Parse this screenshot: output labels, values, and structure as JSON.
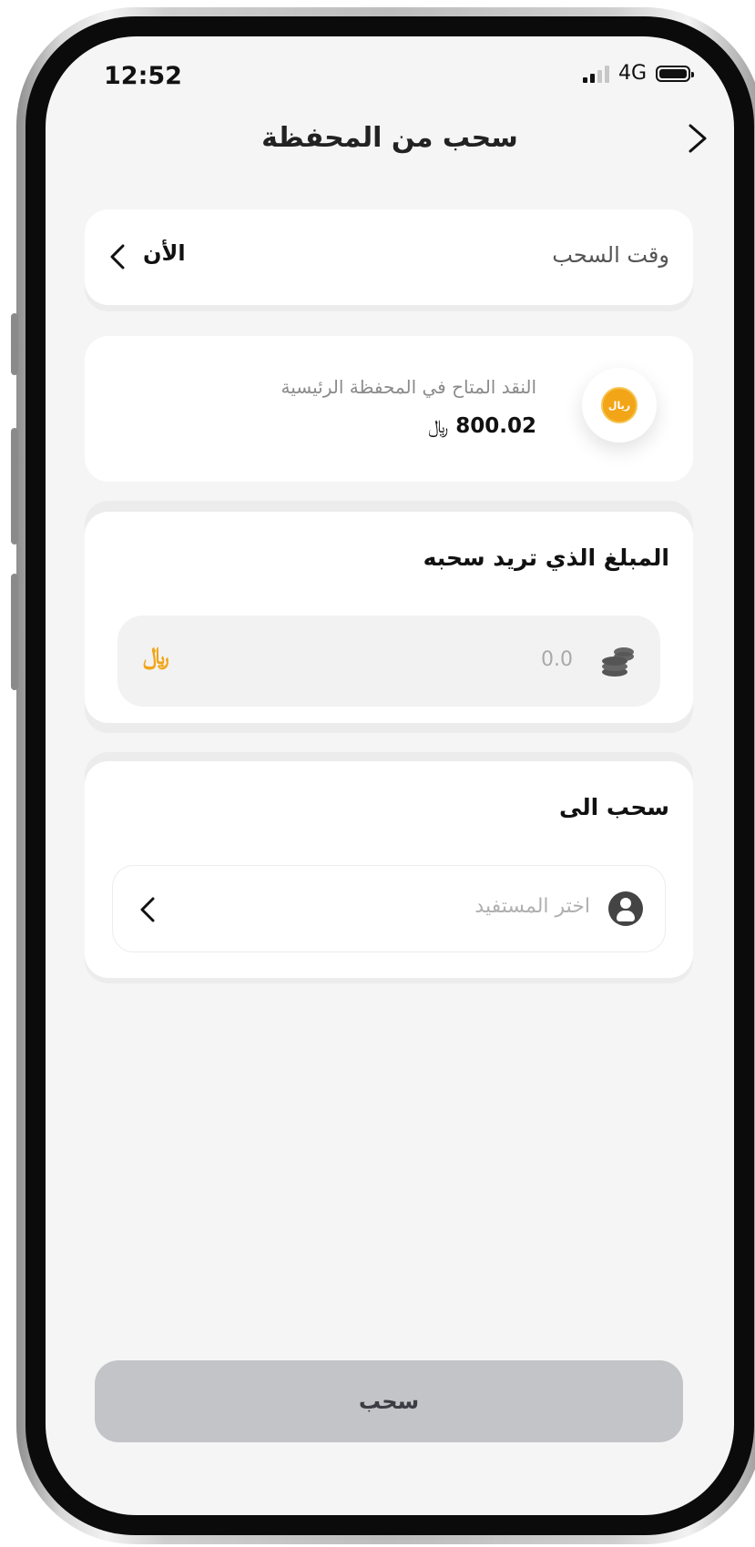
{
  "status_bar": {
    "time": "12:52",
    "network": "4G"
  },
  "header": {
    "title": "سحب من المحفظة"
  },
  "withdraw_time": {
    "label": "وقت السحب",
    "value": "الأن"
  },
  "wallet": {
    "label": "النقد المتاح في المحفظة الرئيسية",
    "balance": "800.02",
    "currency_symbol": "﷼",
    "coin_text": "ريال"
  },
  "amount_section": {
    "title": "المبلغ الذي تريد سحبه",
    "placeholder": "0.0",
    "currency_symbol": "﷼"
  },
  "destination": {
    "title": "سحب الى",
    "placeholder": "اختر المستفيد"
  },
  "cta": {
    "label": "سحب"
  },
  "colors": {
    "accent": "#F2A516",
    "button_disabled": "#C3C4C8",
    "background": "#F5F5F5"
  }
}
